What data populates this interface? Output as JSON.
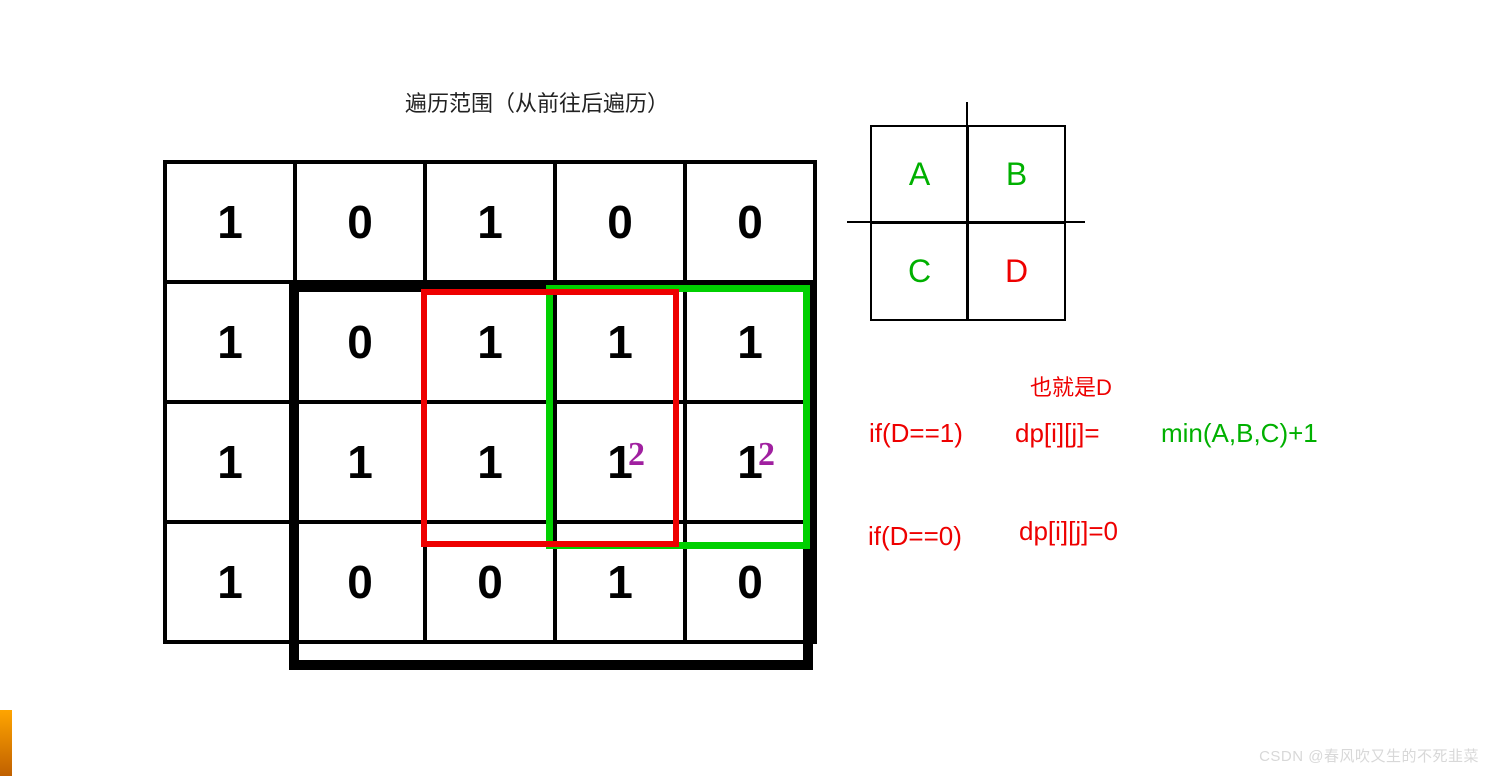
{
  "title": "遍历范围（从前往后遍历）",
  "grid": [
    [
      "1",
      "0",
      "1",
      "0",
      "0"
    ],
    [
      "1",
      "0",
      "1",
      "1",
      "1"
    ],
    [
      "1",
      "1",
      "1",
      "1",
      "1"
    ],
    [
      "1",
      "0",
      "0",
      "1",
      "0"
    ]
  ],
  "annotations": {
    "r2c3": "2",
    "r2c4": "2"
  },
  "small": {
    "A": "A",
    "B": "B",
    "C": "C",
    "D": "D"
  },
  "note1": "也就是D",
  "eq1": {
    "cond": "if(D==1)",
    "dp": "dp[i][j]=",
    "rhs": "min(A,B,C)+1"
  },
  "eq2": {
    "cond": "if(D==0)",
    "dp": "dp[i][j]=0"
  },
  "watermark": "CSDN @春风吹又生的不死韭菜"
}
